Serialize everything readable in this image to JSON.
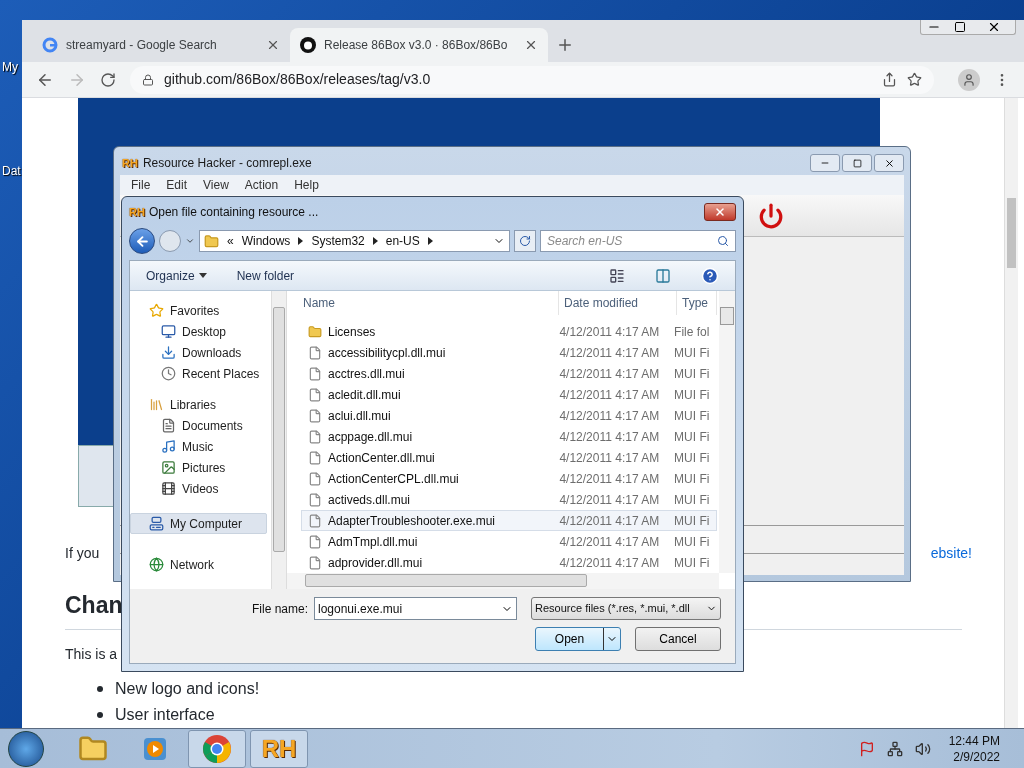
{
  "desktop": {
    "icon_labels": [
      "My",
      "Dat"
    ]
  },
  "browser": {
    "tabs": [
      {
        "title": "streamyard - Google Search",
        "kind": "google",
        "selected": false
      },
      {
        "title": "Release 86Box v3.0 · 86Box/86Bo",
        "kind": "github",
        "selected": true
      }
    ],
    "address": "github.com/86Box/86Box/releases/tag/v3.0",
    "page": {
      "intro": "If you",
      "link": "ebsite!",
      "heading": "Chan",
      "paragraph": "This is a",
      "bullets": [
        "New logo and icons!",
        "User interface"
      ]
    }
  },
  "resource_hacker": {
    "icon_text": "RH",
    "title": "Resource Hacker - comrepl.exe",
    "menu": [
      "File",
      "Edit",
      "View",
      "Action",
      "Help"
    ]
  },
  "open_dialog": {
    "icon_text": "RH",
    "title": "Open file containing resource ...",
    "breadcrumb_prefix": "«",
    "breadcrumb": [
      "Windows",
      "System32",
      "en-US"
    ],
    "search_placeholder": "Search en-US",
    "toolbar": {
      "organize": "Organize",
      "new_folder": "New folder"
    },
    "nav": [
      {
        "label": "Favorites",
        "selected": false,
        "children": [
          {
            "label": "Desktop",
            "selected": false
          },
          {
            "label": "Downloads",
            "selected": false
          },
          {
            "label": "Recent Places",
            "selected": false
          }
        ]
      },
      {
        "label": "Libraries",
        "selected": false,
        "children": [
          {
            "label": "Documents",
            "selected": false
          },
          {
            "label": "Music",
            "selected": false
          },
          {
            "label": "Pictures",
            "selected": false
          },
          {
            "label": "Videos",
            "selected": false
          }
        ]
      },
      {
        "label": "My Computer",
        "selected": true
      },
      {
        "label": "Network",
        "selected": false
      }
    ],
    "columns": [
      "Name",
      "Date modified",
      "Type"
    ],
    "files": [
      {
        "name": "Licenses",
        "date": "4/12/2011 4:17 AM",
        "type": "File fol",
        "kind": "folder",
        "selected": false
      },
      {
        "name": "accessibilitycpl.dll.mui",
        "date": "4/12/2011 4:17 AM",
        "type": "MUI Fi",
        "kind": "file",
        "selected": false
      },
      {
        "name": "acctres.dll.mui",
        "date": "4/12/2011 4:17 AM",
        "type": "MUI Fi",
        "kind": "file",
        "selected": false
      },
      {
        "name": "acledit.dll.mui",
        "date": "4/12/2011 4:17 AM",
        "type": "MUI Fi",
        "kind": "file",
        "selected": false
      },
      {
        "name": "aclui.dll.mui",
        "date": "4/12/2011 4:17 AM",
        "type": "MUI Fi",
        "kind": "file",
        "selected": false
      },
      {
        "name": "acppage.dll.mui",
        "date": "4/12/2011 4:17 AM",
        "type": "MUI Fi",
        "kind": "file",
        "selected": false
      },
      {
        "name": "ActionCenter.dll.mui",
        "date": "4/12/2011 4:17 AM",
        "type": "MUI Fi",
        "kind": "file",
        "selected": false
      },
      {
        "name": "ActionCenterCPL.dll.mui",
        "date": "4/12/2011 4:17 AM",
        "type": "MUI Fi",
        "kind": "file",
        "selected": false
      },
      {
        "name": "activeds.dll.mui",
        "date": "4/12/2011 4:17 AM",
        "type": "MUI Fi",
        "kind": "file",
        "selected": false
      },
      {
        "name": "AdapterTroubleshooter.exe.mui",
        "date": "4/12/2011 4:17 AM",
        "type": "MUI Fi",
        "kind": "file",
        "selected": true
      },
      {
        "name": "AdmTmpl.dll.mui",
        "date": "4/12/2011 4:17 AM",
        "type": "MUI Fi",
        "kind": "file",
        "selected": false
      },
      {
        "name": "adprovider.dll.mui",
        "date": "4/12/2011 4:17 AM",
        "type": "MUI Fi",
        "kind": "file",
        "selected": false
      }
    ],
    "file_name_label": "File name:",
    "file_name": "logonui.exe.mui",
    "filter": "Resource files (*.res, *.mui, *.dll",
    "open": "Open",
    "cancel": "Cancel"
  },
  "taskbar": {
    "apps": [
      {
        "kind": "explorer",
        "open": false
      },
      {
        "kind": "media_player",
        "open": false
      },
      {
        "kind": "chrome",
        "open": true
      },
      {
        "kind": "resource_hacker",
        "open": true,
        "icon_text": "RH"
      }
    ],
    "time": "12:44 PM",
    "date": "2/9/2022"
  }
}
